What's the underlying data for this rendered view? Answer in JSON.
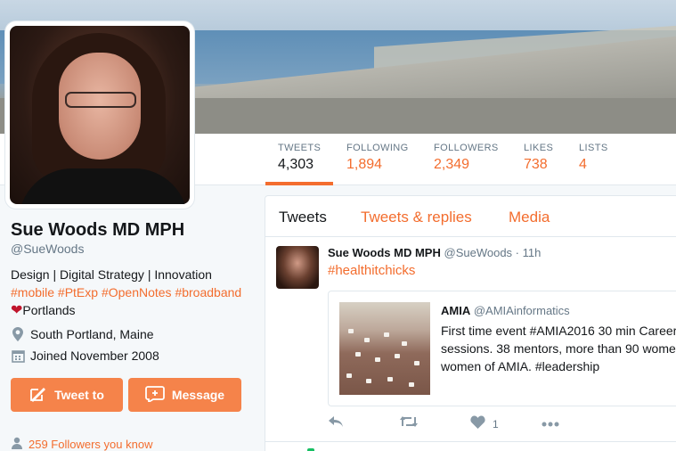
{
  "profile": {
    "name": "Sue Woods MD MPH",
    "handle": "@SueWoods",
    "bio_line1": "Design | Digital Strategy | Innovation",
    "bio_tags": "#mobile #PtExp #OpenNotes #broadband",
    "bio_line3": "Portlands",
    "location": "South Portland, Maine",
    "joined": "Joined November 2008",
    "tweet_to_label": "Tweet to",
    "message_label": "Message",
    "followers_you_know": "259 Followers you know"
  },
  "stats": [
    {
      "label": "TWEETS",
      "value": "4,303"
    },
    {
      "label": "FOLLOWING",
      "value": "1,894"
    },
    {
      "label": "FOLLOWERS",
      "value": "2,349"
    },
    {
      "label": "LIKES",
      "value": "738"
    },
    {
      "label": "LISTS",
      "value": "4"
    }
  ],
  "tabs": [
    "Tweets",
    "Tweets & replies",
    "Media"
  ],
  "tweet": {
    "name": "Sue Woods MD MPH",
    "meta": "@SueWoods · 11h",
    "text": "#healthitchicks",
    "quote": {
      "name": "AMIA",
      "handle": "@AMIAinformatics",
      "text": "First time event #AMIA2016 30 min Career sessions. 38 mentors, more than 90 wome the women of AMIA. #leadership"
    },
    "like_count": "1"
  },
  "colors": {
    "accent": "#f36d2e",
    "button": "#f5834a",
    "heart": "#c0152c"
  },
  "icons": [
    "location-icon",
    "calendar-icon",
    "reply-icon",
    "retweet-icon",
    "heart-icon",
    "more-icon",
    "followers-icon"
  ]
}
